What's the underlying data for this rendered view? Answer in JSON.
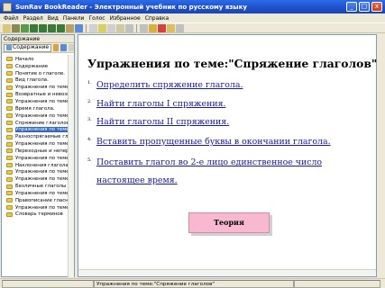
{
  "titlebar": {
    "title": "SunRav BookReader - Электронный учебник по русскому языку",
    "buttons": {
      "minimize": "_",
      "maximize": "□",
      "close": "x"
    }
  },
  "menubar": {
    "items": [
      "Файл",
      "Раздел",
      "Вид",
      "Панели",
      "Голос",
      "Избранное",
      "Справка"
    ]
  },
  "toolbar": {
    "button_colors": [
      "#d8c878",
      "#8a8a50",
      "#5a9a4a",
      "#3a7a3a",
      "#3a7a3a",
      "#3a7a3a",
      "#3a7a3a",
      "#b8a060",
      "#5a8ad8",
      "#d0d0d0",
      "#d8d060",
      "#d0d0d0",
      "#d0c8a0",
      "#c0c0c0",
      "#c0c0c0",
      "#d8b040",
      "#d84040",
      "#d8c060",
      "#c0c0c0"
    ]
  },
  "sidebar": {
    "header": "Содержание",
    "tab_label": "Содержание",
    "items": [
      "Начало",
      "Содержание",
      "Понятие о глаголе.",
      "Вид глагола.",
      "Упражнения по теме \"",
      "Возвратные и невозв",
      "Упражнения по теме \"",
      "Время глагола.",
      "Упражнения по теме \"",
      "Спряжение глаголов",
      "Упражнения по теме:\"",
      "Разноспрягаемые гла",
      "Упражнения по теме \"",
      "Переходные и непере",
      "Упражнения по теме \"",
      "Наклонения глагола",
      "Упражнения по теме \"",
      "Упражнения по теме \"",
      "Безличные глаголы",
      "Упражнения по теме \"",
      "Правописание гласны",
      "Упражнения по теме \"",
      "Словарь терминов"
    ],
    "selected_index": 10
  },
  "content": {
    "title": "Упражнения по теме:\"Спряжение глаголов\"",
    "exercises": [
      {
        "num": "1.",
        "text": "Определить спряжение глагола."
      },
      {
        "num": "2.",
        "text": "Найти глаголы I спряжения."
      },
      {
        "num": "3.",
        "text": "Найти глаголы II спряжения."
      },
      {
        "num": "4.",
        "text": "Вставить пропущенные буквы в окончании глагола."
      },
      {
        "num": "5.",
        "text": "Поставить глагол во 2-е лицо единственное число"
      }
    ],
    "exercise5_continuation": "настоящее время.",
    "theory_button": "Теория"
  },
  "statusbar": {
    "text": "Упражнения по теме:\"Спряжение глаголов\""
  }
}
